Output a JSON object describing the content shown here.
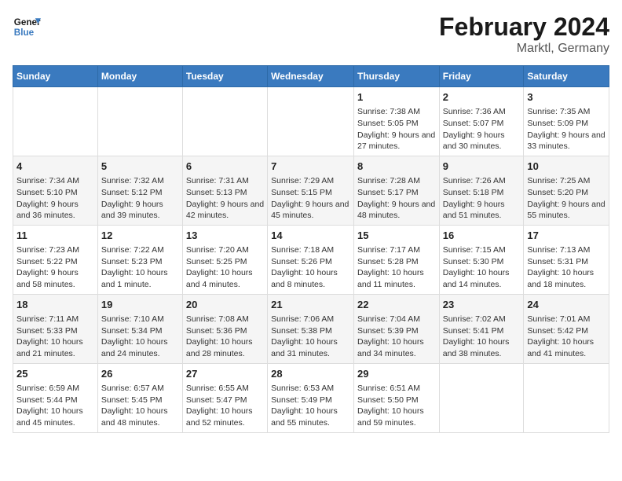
{
  "header": {
    "logo_general": "General",
    "logo_blue": "Blue",
    "main_title": "February 2024",
    "sub_title": "Marktl, Germany"
  },
  "calendar": {
    "days_of_week": [
      "Sunday",
      "Monday",
      "Tuesday",
      "Wednesday",
      "Thursday",
      "Friday",
      "Saturday"
    ],
    "weeks": [
      [
        {
          "day": "",
          "info": ""
        },
        {
          "day": "",
          "info": ""
        },
        {
          "day": "",
          "info": ""
        },
        {
          "day": "",
          "info": ""
        },
        {
          "day": "1",
          "info": "Sunrise: 7:38 AM\nSunset: 5:05 PM\nDaylight: 9 hours and 27 minutes."
        },
        {
          "day": "2",
          "info": "Sunrise: 7:36 AM\nSunset: 5:07 PM\nDaylight: 9 hours and 30 minutes."
        },
        {
          "day": "3",
          "info": "Sunrise: 7:35 AM\nSunset: 5:09 PM\nDaylight: 9 hours and 33 minutes."
        }
      ],
      [
        {
          "day": "4",
          "info": "Sunrise: 7:34 AM\nSunset: 5:10 PM\nDaylight: 9 hours and 36 minutes."
        },
        {
          "day": "5",
          "info": "Sunrise: 7:32 AM\nSunset: 5:12 PM\nDaylight: 9 hours and 39 minutes."
        },
        {
          "day": "6",
          "info": "Sunrise: 7:31 AM\nSunset: 5:13 PM\nDaylight: 9 hours and 42 minutes."
        },
        {
          "day": "7",
          "info": "Sunrise: 7:29 AM\nSunset: 5:15 PM\nDaylight: 9 hours and 45 minutes."
        },
        {
          "day": "8",
          "info": "Sunrise: 7:28 AM\nSunset: 5:17 PM\nDaylight: 9 hours and 48 minutes."
        },
        {
          "day": "9",
          "info": "Sunrise: 7:26 AM\nSunset: 5:18 PM\nDaylight: 9 hours and 51 minutes."
        },
        {
          "day": "10",
          "info": "Sunrise: 7:25 AM\nSunset: 5:20 PM\nDaylight: 9 hours and 55 minutes."
        }
      ],
      [
        {
          "day": "11",
          "info": "Sunrise: 7:23 AM\nSunset: 5:22 PM\nDaylight: 9 hours and 58 minutes."
        },
        {
          "day": "12",
          "info": "Sunrise: 7:22 AM\nSunset: 5:23 PM\nDaylight: 10 hours and 1 minute."
        },
        {
          "day": "13",
          "info": "Sunrise: 7:20 AM\nSunset: 5:25 PM\nDaylight: 10 hours and 4 minutes."
        },
        {
          "day": "14",
          "info": "Sunrise: 7:18 AM\nSunset: 5:26 PM\nDaylight: 10 hours and 8 minutes."
        },
        {
          "day": "15",
          "info": "Sunrise: 7:17 AM\nSunset: 5:28 PM\nDaylight: 10 hours and 11 minutes."
        },
        {
          "day": "16",
          "info": "Sunrise: 7:15 AM\nSunset: 5:30 PM\nDaylight: 10 hours and 14 minutes."
        },
        {
          "day": "17",
          "info": "Sunrise: 7:13 AM\nSunset: 5:31 PM\nDaylight: 10 hours and 18 minutes."
        }
      ],
      [
        {
          "day": "18",
          "info": "Sunrise: 7:11 AM\nSunset: 5:33 PM\nDaylight: 10 hours and 21 minutes."
        },
        {
          "day": "19",
          "info": "Sunrise: 7:10 AM\nSunset: 5:34 PM\nDaylight: 10 hours and 24 minutes."
        },
        {
          "day": "20",
          "info": "Sunrise: 7:08 AM\nSunset: 5:36 PM\nDaylight: 10 hours and 28 minutes."
        },
        {
          "day": "21",
          "info": "Sunrise: 7:06 AM\nSunset: 5:38 PM\nDaylight: 10 hours and 31 minutes."
        },
        {
          "day": "22",
          "info": "Sunrise: 7:04 AM\nSunset: 5:39 PM\nDaylight: 10 hours and 34 minutes."
        },
        {
          "day": "23",
          "info": "Sunrise: 7:02 AM\nSunset: 5:41 PM\nDaylight: 10 hours and 38 minutes."
        },
        {
          "day": "24",
          "info": "Sunrise: 7:01 AM\nSunset: 5:42 PM\nDaylight: 10 hours and 41 minutes."
        }
      ],
      [
        {
          "day": "25",
          "info": "Sunrise: 6:59 AM\nSunset: 5:44 PM\nDaylight: 10 hours and 45 minutes."
        },
        {
          "day": "26",
          "info": "Sunrise: 6:57 AM\nSunset: 5:45 PM\nDaylight: 10 hours and 48 minutes."
        },
        {
          "day": "27",
          "info": "Sunrise: 6:55 AM\nSunset: 5:47 PM\nDaylight: 10 hours and 52 minutes."
        },
        {
          "day": "28",
          "info": "Sunrise: 6:53 AM\nSunset: 5:49 PM\nDaylight: 10 hours and 55 minutes."
        },
        {
          "day": "29",
          "info": "Sunrise: 6:51 AM\nSunset: 5:50 PM\nDaylight: 10 hours and 59 minutes."
        },
        {
          "day": "",
          "info": ""
        },
        {
          "day": "",
          "info": ""
        }
      ]
    ]
  }
}
